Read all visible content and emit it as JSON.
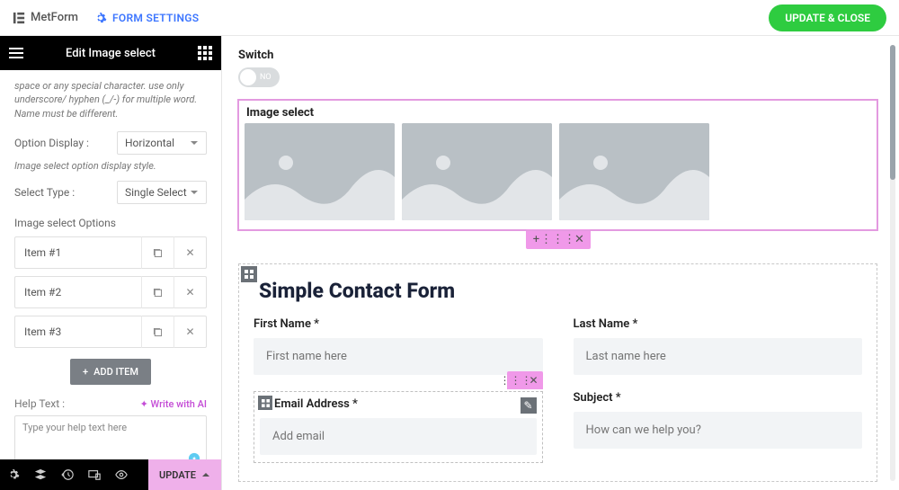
{
  "topbar": {
    "brand": "MetForm",
    "settings_label": "FORM SETTINGS",
    "update_close": "UPDATE & CLOSE"
  },
  "panel": {
    "title": "Edit Image select",
    "name_help": "space or any special character. use only underscore/ hyphen (_/-) for multiple word. Name must be different.",
    "option_display_label": "Option Display :",
    "option_display_value": "Horizontal",
    "option_display_hint": "Image select option display style.",
    "select_type_label": "Select Type :",
    "select_type_value": "Single Select",
    "options_label": "Image select Options",
    "options": [
      {
        "label": "Item #1"
      },
      {
        "label": "Item #2"
      },
      {
        "label": "Item #3"
      }
    ],
    "add_item": "ADD ITEM",
    "help_text_label": "Help Text :",
    "write_ai": "✦ Write with AI",
    "help_text_placeholder": "Type your help text here"
  },
  "footer": {
    "update": "UPDATE"
  },
  "canvas": {
    "switch_label": "Switch",
    "switch_value": "NO",
    "image_select_title": "Image select",
    "contact_title": "Simple Contact Form",
    "first_name_label": "First Name *",
    "first_name_ph": "First name here",
    "last_name_label": "Last Name *",
    "last_name_ph": "Last name here",
    "email_label": "Email Address *",
    "email_ph": "Add email",
    "subject_label": "Subject *",
    "subject_ph": "How can we help you?"
  }
}
